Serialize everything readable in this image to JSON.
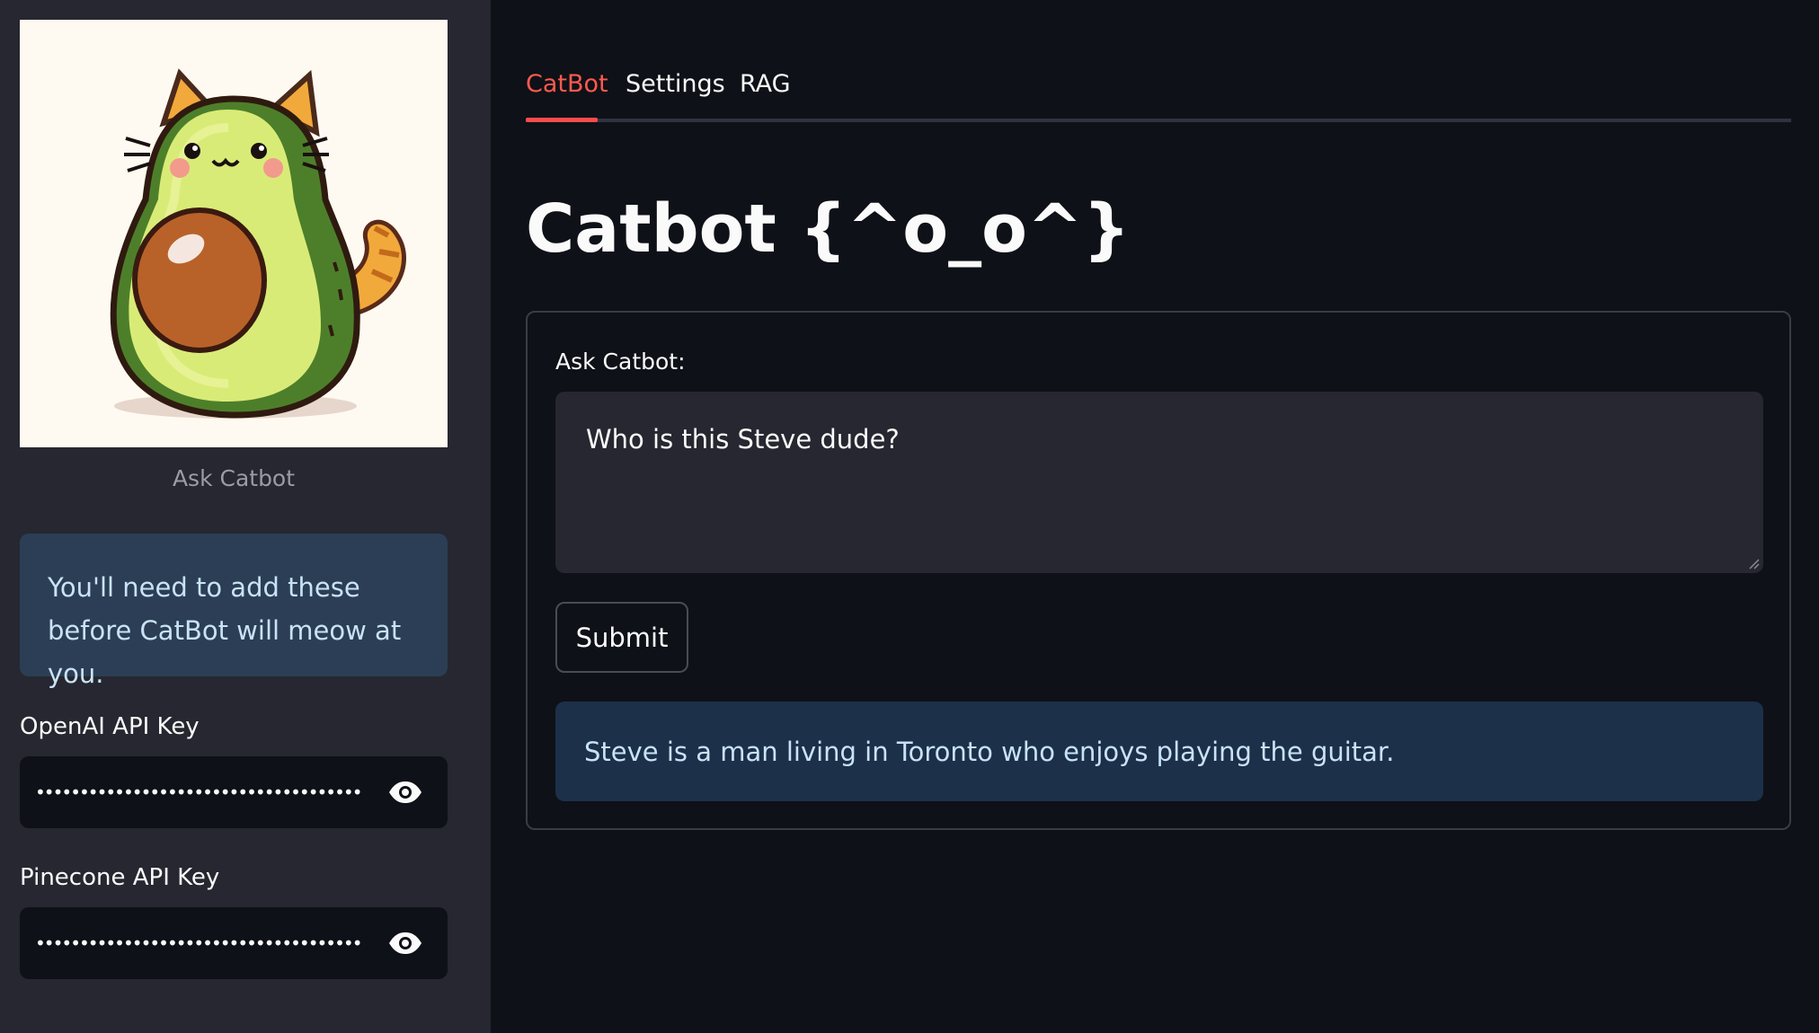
{
  "sidebar": {
    "logo_caption": "Ask Catbot",
    "info_message": "You'll need to add these before CatBot will meow at you.",
    "openai": {
      "label": "OpenAI API Key",
      "masked_value": "••••••••••••••••••••••••••••••••••••••••••••"
    },
    "pinecone": {
      "label": "Pinecone API Key",
      "masked_value": "••••••••••••••••••••••••••••••••••••••••••••"
    },
    "eye_icon": "eye-icon"
  },
  "tabs": [
    {
      "label": "CatBot",
      "active": true
    },
    {
      "label": "Settings",
      "active": false
    },
    {
      "label": "RAG",
      "active": false
    }
  ],
  "main": {
    "title": "Catbot {^o_o^}",
    "form": {
      "question_label": "Ask Catbot:",
      "question_value": "Who is this Steve dude?",
      "submit_label": "Submit",
      "answer": "Steve is a man living in Toronto who enjoys playing the guitar."
    }
  },
  "colors": {
    "accent": "#ff4b4b",
    "sidebar_bg": "#262730",
    "app_bg": "#0e1117",
    "info_bg": "#2c3e55",
    "answer_bg": "#1d3049"
  }
}
